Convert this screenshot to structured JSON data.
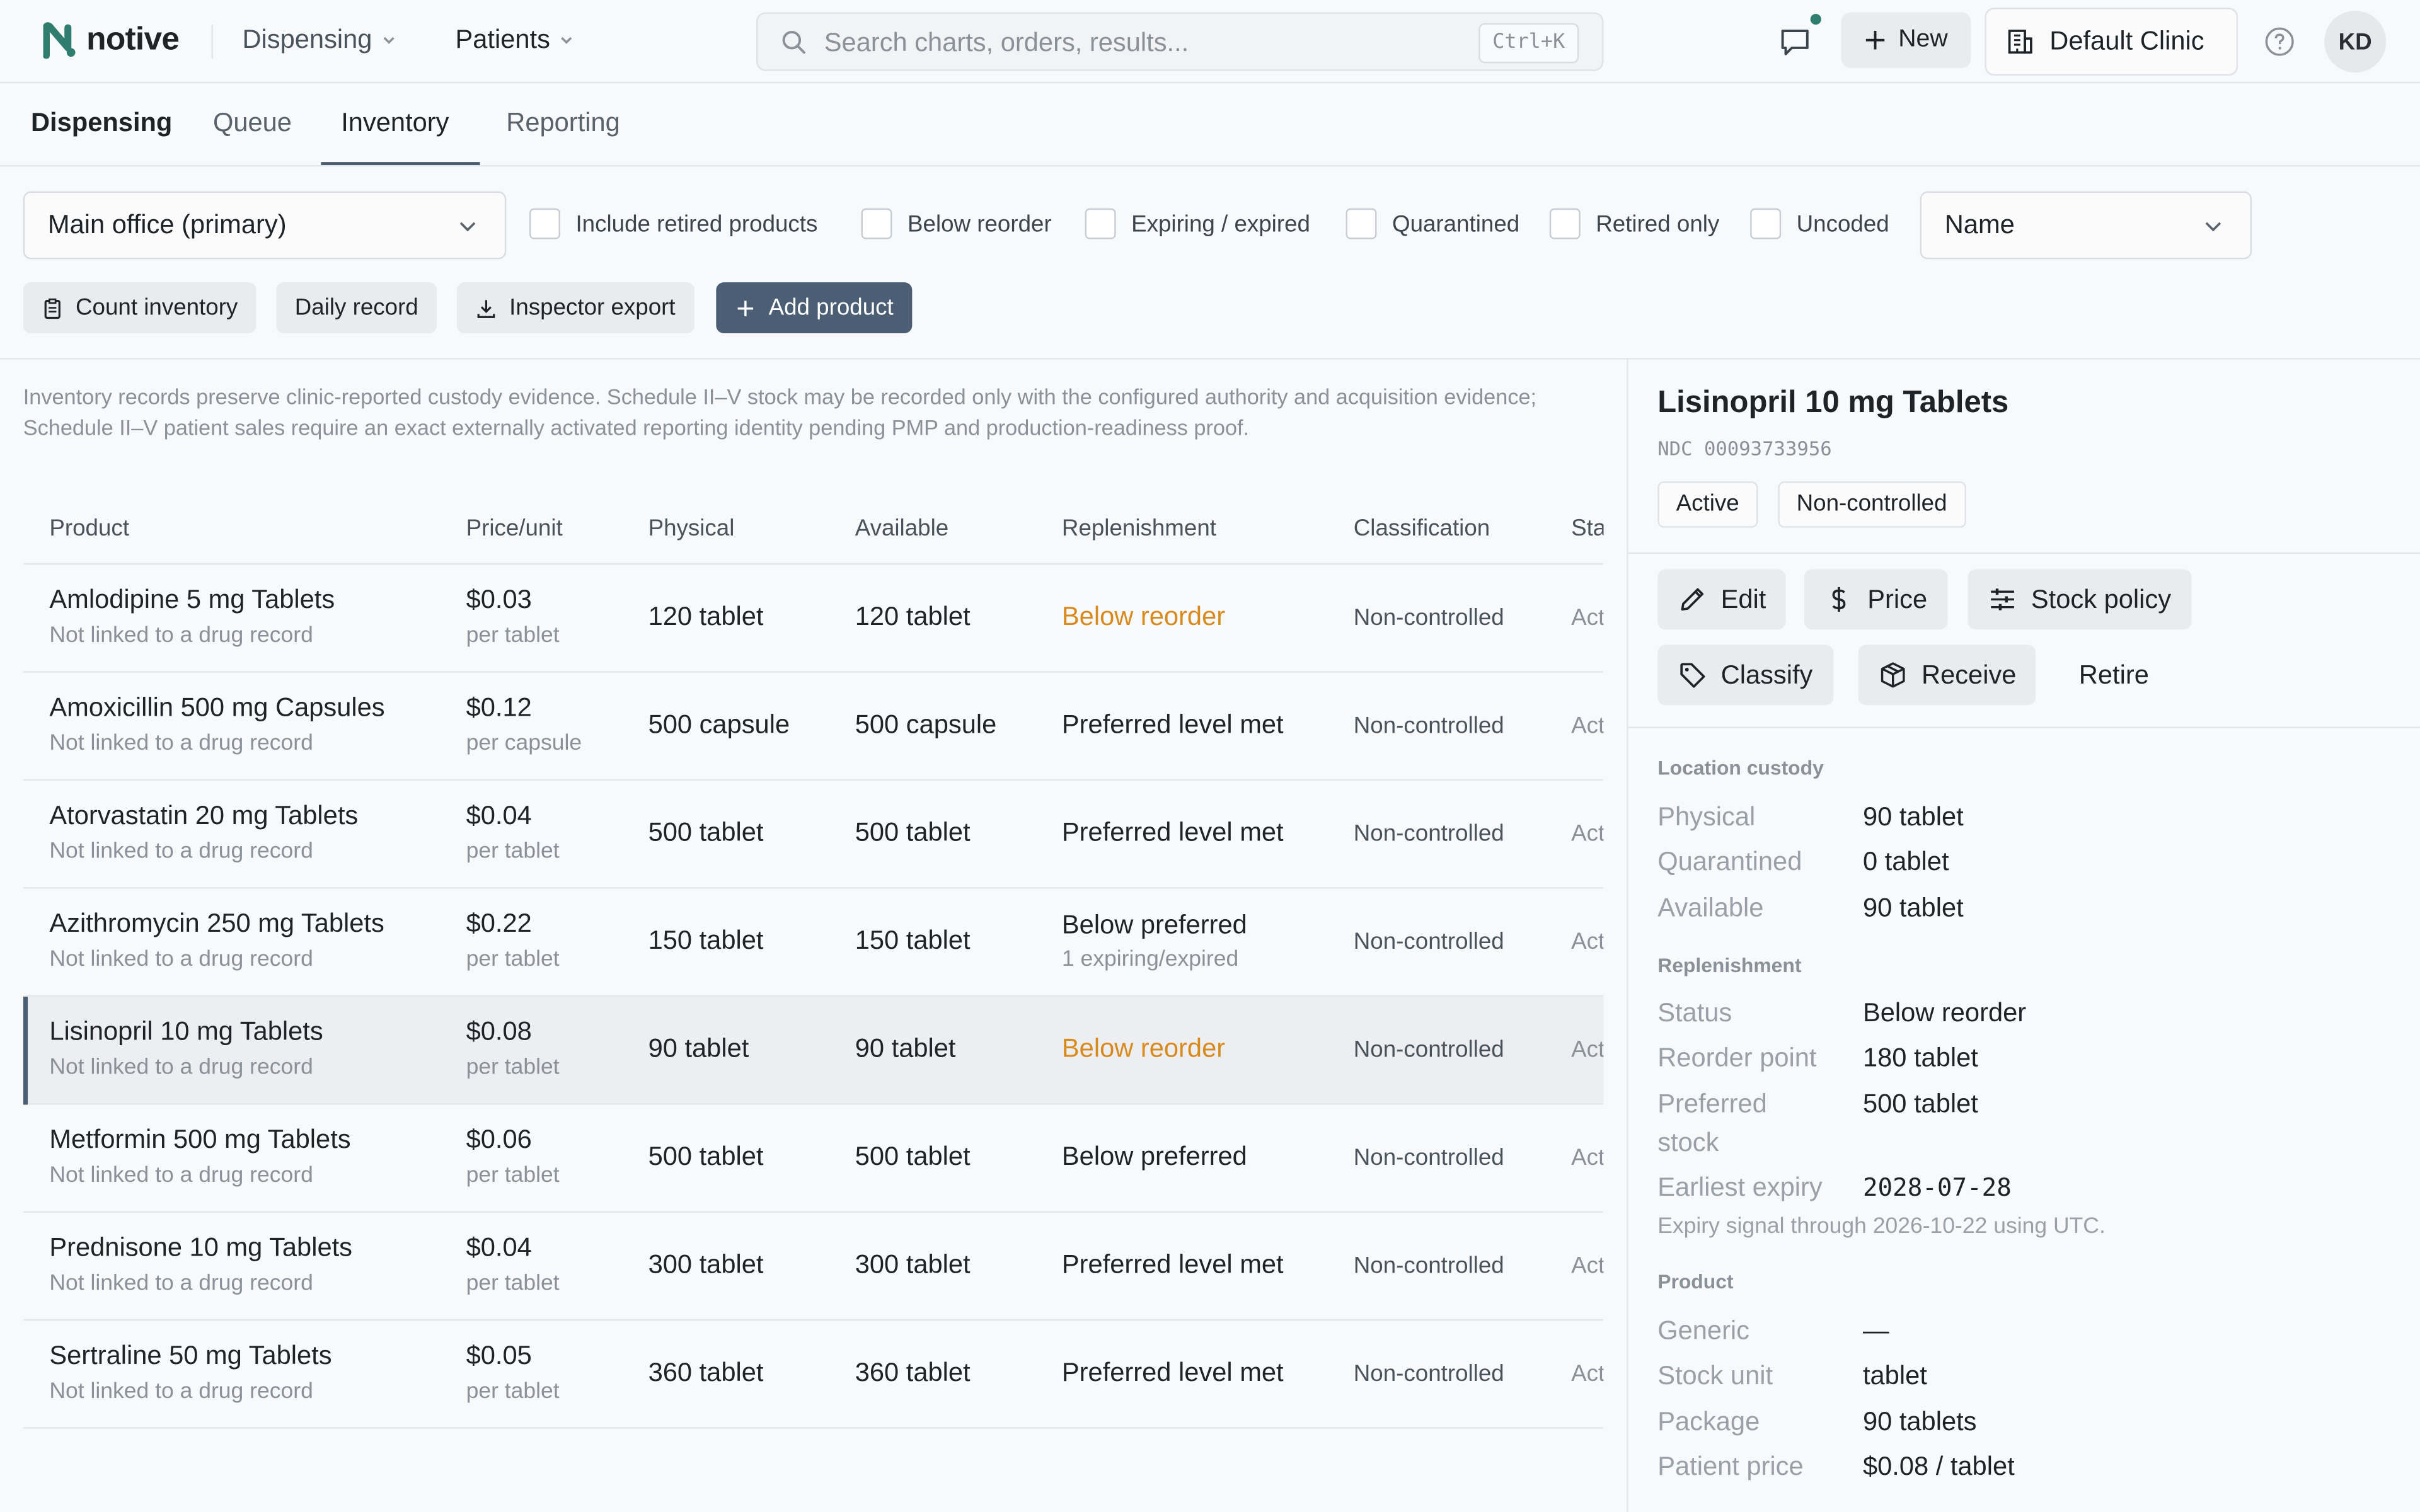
{
  "brand": {
    "name": "notive",
    "accent": "#2e7d6e"
  },
  "topnav": {
    "dispensing": "Dispensing",
    "patients": "Patients"
  },
  "search": {
    "placeholder": "Search charts, orders, results...",
    "shortcut": "Ctrl+K"
  },
  "header": {
    "new_label": "New",
    "clinic_label": "Default Clinic",
    "avatar_initials": "KD"
  },
  "subtabs": {
    "dispensing": "Dispensing",
    "queue": "Queue",
    "inventory": "Inventory",
    "reporting": "Reporting",
    "active": "Inventory"
  },
  "filters": {
    "location": "Main office (primary)",
    "checkboxes": [
      "Include retired products",
      "Below reorder",
      "Expiring / expired",
      "Quarantined",
      "Retired only",
      "Uncoded"
    ],
    "sort": "Name"
  },
  "actions": {
    "count": "Count inventory",
    "daily": "Daily record",
    "export": "Inspector export",
    "add": "Add product"
  },
  "notice": "Inventory records preserve clinic-reported custody evidence. Schedule II–V stock may be recorded only with the configured authority and acquisition evidence; Schedule II–V patient sales require an exact externally activated reporting identity pending PMP and production-readiness proof.",
  "table": {
    "columns": [
      "Product",
      "Price/unit",
      "Physical",
      "Available",
      "Replenishment",
      "Classification",
      "Status"
    ],
    "status_visible": "Sta",
    "rows": [
      {
        "name": "Amlodipine 5 mg Tablets",
        "sub": "Not linked to a drug record",
        "price": "$0.03",
        "unit": "per tablet",
        "physical": "120 tablet",
        "available": "120 tablet",
        "replenishment": "Below reorder",
        "rep_sub": "",
        "classification": "Non-controlled",
        "status": "Act"
      },
      {
        "name": "Amoxicillin 500 mg Capsules",
        "sub": "Not linked to a drug record",
        "price": "$0.12",
        "unit": "per capsule",
        "physical": "500 capsule",
        "available": "500 capsule",
        "replenishment": "Preferred level met",
        "rep_sub": "",
        "classification": "Non-controlled",
        "status": "Act"
      },
      {
        "name": "Atorvastatin 20 mg Tablets",
        "sub": "Not linked to a drug record",
        "price": "$0.04",
        "unit": "per tablet",
        "physical": "500 tablet",
        "available": "500 tablet",
        "replenishment": "Preferred level met",
        "rep_sub": "",
        "classification": "Non-controlled",
        "status": "Act"
      },
      {
        "name": "Azithromycin 250 mg Tablets",
        "sub": "Not linked to a drug record",
        "price": "$0.22",
        "unit": "per tablet",
        "physical": "150 tablet",
        "available": "150 tablet",
        "replenishment": "Below preferred",
        "rep_sub": "1 expiring/expired",
        "classification": "Non-controlled",
        "status": "Act"
      },
      {
        "name": "Lisinopril 10 mg Tablets",
        "sub": "Not linked to a drug record",
        "price": "$0.08",
        "unit": "per tablet",
        "physical": "90 tablet",
        "available": "90 tablet",
        "replenishment": "Below reorder",
        "rep_sub": "",
        "classification": "Non-controlled",
        "status": "Act"
      },
      {
        "name": "Metformin 500 mg Tablets",
        "sub": "Not linked to a drug record",
        "price": "$0.06",
        "unit": "per tablet",
        "physical": "500 tablet",
        "available": "500 tablet",
        "replenishment": "Below preferred",
        "rep_sub": "",
        "classification": "Non-controlled",
        "status": "Act"
      },
      {
        "name": "Prednisone 10 mg Tablets",
        "sub": "Not linked to a drug record",
        "price": "$0.04",
        "unit": "per tablet",
        "physical": "300 tablet",
        "available": "300 tablet",
        "replenishment": "Preferred level met",
        "rep_sub": "",
        "classification": "Non-controlled",
        "status": "Act"
      },
      {
        "name": "Sertraline 50 mg Tablets",
        "sub": "Not linked to a drug record",
        "price": "$0.05",
        "unit": "per tablet",
        "physical": "360 tablet",
        "available": "360 tablet",
        "replenishment": "Preferred level met",
        "rep_sub": "",
        "classification": "Non-controlled",
        "status": "Act"
      }
    ]
  },
  "detail": {
    "title": "Lisinopril 10 mg Tablets",
    "ndc": "NDC 00093733956",
    "pills": [
      "Active",
      "Non-controlled"
    ],
    "buttons": {
      "edit": "Edit",
      "price": "Price",
      "stock_policy": "Stock policy",
      "classify": "Classify",
      "receive": "Receive",
      "retire": "Retire"
    },
    "custody": {
      "heading": "Location custody",
      "physical_k": "Physical",
      "physical_v": "90 tablet",
      "quarantined_k": "Quarantined",
      "quarantined_v": "0 tablet",
      "available_k": "Available",
      "available_v": "90 tablet"
    },
    "replenishment": {
      "heading": "Replenishment",
      "status_k": "Status",
      "status_v": "Below reorder",
      "reorder_k": "Reorder point",
      "reorder_v": "180 tablet",
      "preferred_k1": "Preferred",
      "preferred_k2": "stock",
      "preferred_v": "500 tablet",
      "expiry_k": "Earliest expiry",
      "expiry_v": "2028-07-28",
      "note": "Expiry signal through 2026-10-22 using UTC."
    },
    "product": {
      "heading": "Product",
      "generic_k": "Generic",
      "generic_v": "—",
      "unit_k": "Stock unit",
      "unit_v": "tablet",
      "package_k": "Package",
      "package_v": "90 tablets",
      "price_k": "Patient price",
      "price_v": "$0.08 / tablet"
    }
  },
  "colors": {
    "warning": "#d98a1c",
    "primary_button": "#4b5e73",
    "selected_row": "#eceef1"
  }
}
